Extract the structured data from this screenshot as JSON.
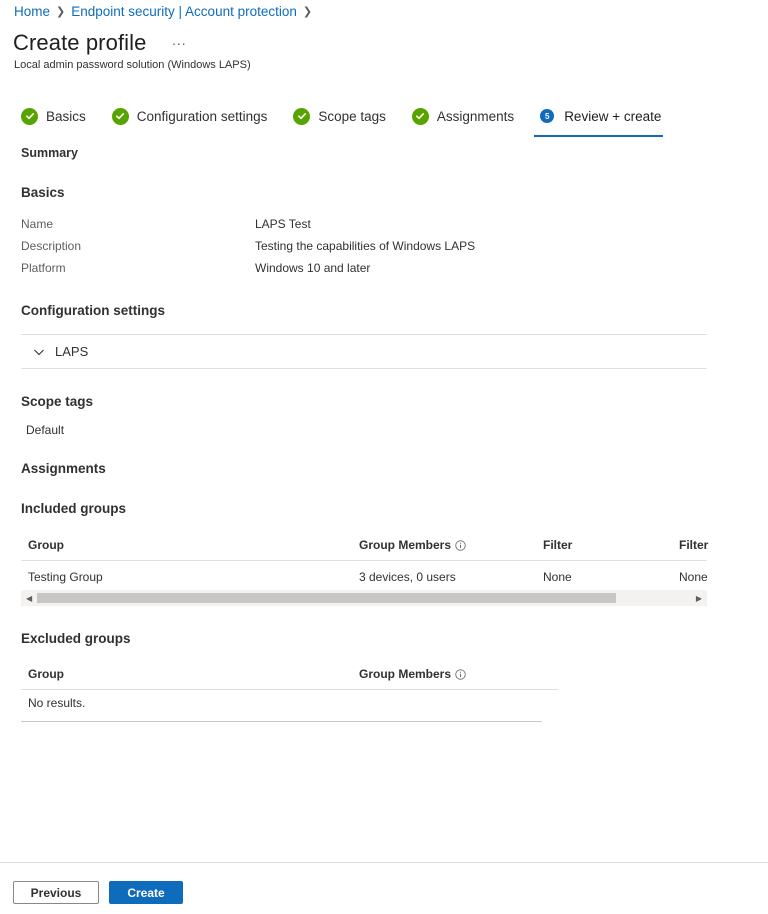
{
  "breadcrumb": {
    "home": "Home",
    "section": "Endpoint security | Account protection"
  },
  "page": {
    "title": "Create profile",
    "more": "...",
    "subtitle": "Local admin password solution (Windows LAPS)"
  },
  "steps": [
    {
      "label": "Basics",
      "state": "complete"
    },
    {
      "label": "Configuration settings",
      "state": "complete"
    },
    {
      "label": "Scope tags",
      "state": "complete"
    },
    {
      "label": "Assignments",
      "state": "complete"
    },
    {
      "label": "Review + create",
      "state": "active",
      "number": "5"
    }
  ],
  "summary": {
    "label": "Summary",
    "basics": {
      "heading": "Basics",
      "rows": [
        {
          "label": "Name",
          "value": "LAPS Test"
        },
        {
          "label": "Description",
          "value": "Testing the capabilities of Windows LAPS"
        },
        {
          "label": "Platform",
          "value": "Windows 10 and later"
        }
      ]
    },
    "configuration": {
      "heading": "Configuration settings",
      "group_label": "LAPS"
    },
    "scope_tags": {
      "heading": "Scope tags",
      "value": "Default"
    },
    "assignments": {
      "heading": "Assignments",
      "included": {
        "heading": "Included groups",
        "columns": [
          "Group",
          "Group Members",
          "Filter",
          "Filter"
        ],
        "rows": [
          [
            "Testing Group",
            "3 devices, 0 users",
            "None",
            "None"
          ]
        ]
      },
      "excluded": {
        "heading": "Excluded groups",
        "columns": [
          "Group",
          "Group Members"
        ],
        "empty": "No results."
      }
    }
  },
  "footer": {
    "previous": "Previous",
    "create": "Create"
  },
  "colors": {
    "accent": "#0f6cbd",
    "success": "#57a300"
  }
}
